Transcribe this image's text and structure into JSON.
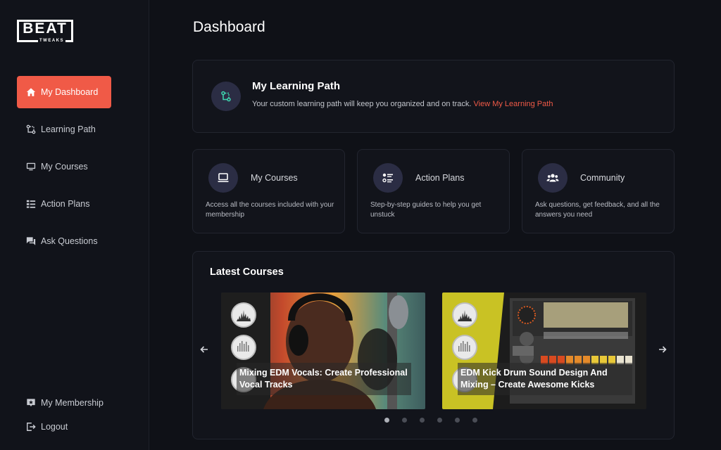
{
  "brand": {
    "logo_main": "BEAT",
    "logo_sub": "TWEAKS"
  },
  "sidebar": {
    "items": [
      {
        "label": "My Dashboard",
        "icon": "home-icon",
        "active": true
      },
      {
        "label": "Learning Path",
        "icon": "path-icon"
      },
      {
        "label": "My Courses",
        "icon": "monitor-icon"
      },
      {
        "label": "Action Plans",
        "icon": "list-icon"
      },
      {
        "label": "Ask Questions",
        "icon": "chat-icon"
      }
    ],
    "bottom": [
      {
        "label": "My Membership",
        "icon": "membership-icon"
      },
      {
        "label": "Logout",
        "icon": "logout-icon"
      }
    ]
  },
  "page": {
    "title": "Dashboard"
  },
  "learning_path": {
    "title": "My Learning Path",
    "desc": "Your custom learning path will keep you organized and on track.",
    "link": "View My Learning Path"
  },
  "features": [
    {
      "title": "My Courses",
      "desc": "Access all the courses included with your membership",
      "icon": "laptop-icon"
    },
    {
      "title": "Action Plans",
      "desc": "Step-by-step guides to help you get unstuck",
      "icon": "checklist-icon"
    },
    {
      "title": "Community",
      "desc": "Ask questions, get feedback, and all the answers you need",
      "icon": "people-icon"
    }
  ],
  "latest": {
    "title": "Latest Courses",
    "courses": [
      {
        "title": "Mixing EDM Vocals: Create Professional Vocal Tracks"
      },
      {
        "title": "EDM Kick Drum Sound Design And Mixing – Create Awesome Kicks"
      }
    ],
    "dots": 6,
    "active_dot": 0
  },
  "colors": {
    "accent": "#f05a47",
    "bg": "#0f1117",
    "card": "#12141b",
    "icon_circle": "#2b2d44",
    "teal": "#3fd6b0"
  }
}
